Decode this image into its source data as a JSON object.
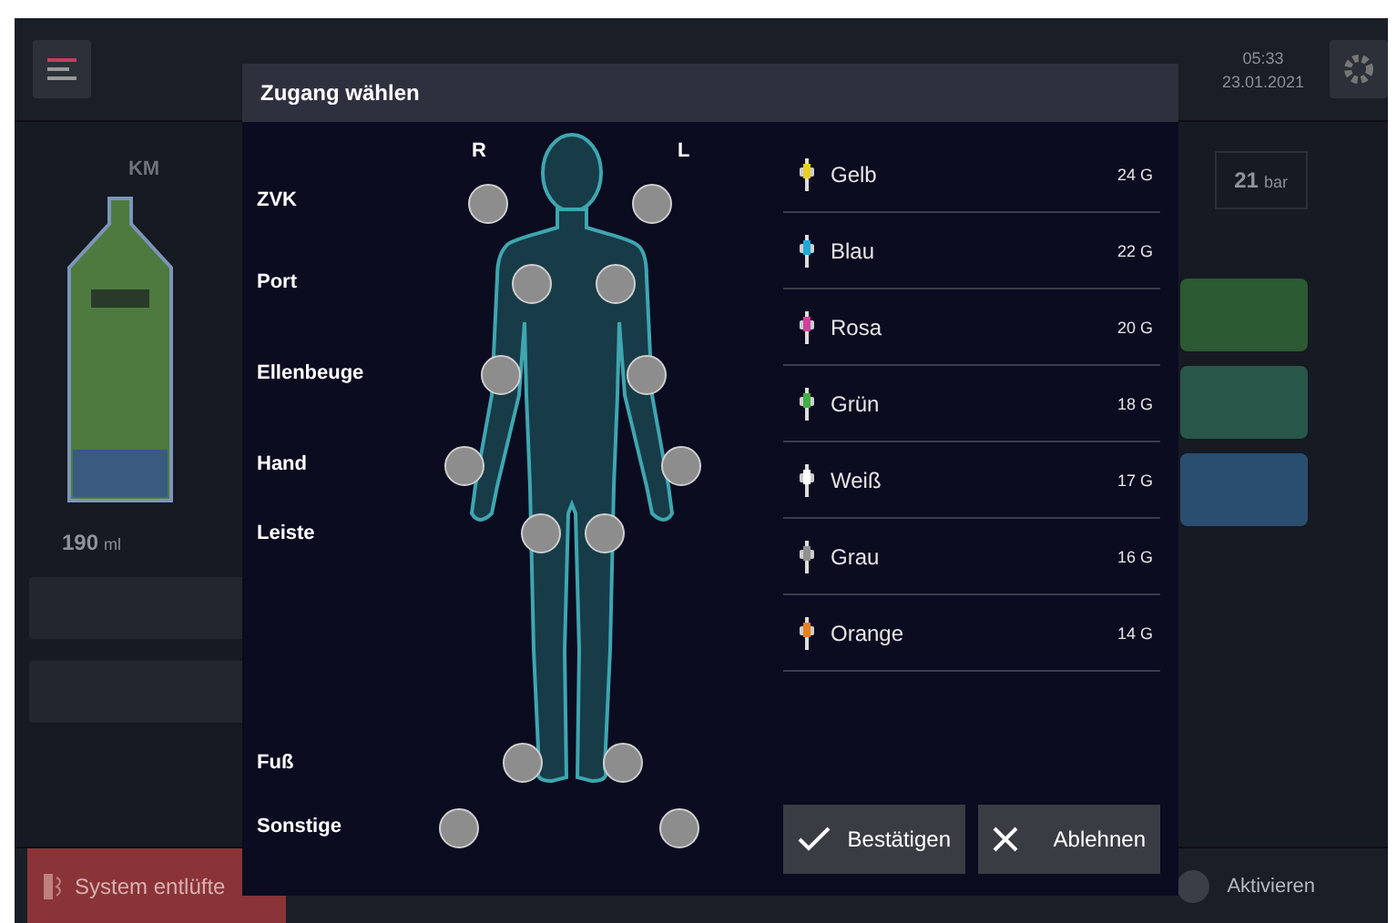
{
  "top_bar": {
    "time": "05:33",
    "date": "23.01.2021"
  },
  "left_panel": {
    "label": "KM",
    "volume": "190",
    "unit": "ml"
  },
  "right_panel": {
    "pressure": "21",
    "unit": "bar"
  },
  "bottom_bar": {
    "vent_button": "System entlüfte",
    "activate": "Aktivieren"
  },
  "dialog": {
    "title": "Zugang wählen",
    "side_labels": [
      "R",
      "L"
    ],
    "sites": [
      {
        "label": "ZVK",
        "points": [
          {
            "selected": false
          },
          {
            "selected": false
          }
        ]
      },
      {
        "label": "Port",
        "points": [
          {
            "selected": false
          },
          {
            "selected": false
          }
        ]
      },
      {
        "label": "Ellenbeuge",
        "points": [
          {
            "selected": false
          },
          {
            "selected": false
          }
        ]
      },
      {
        "label": "Hand",
        "points": [
          {
            "selected": false
          },
          {
            "selected": false
          }
        ]
      },
      {
        "label": "Leiste",
        "points": [
          {
            "selected": false
          },
          {
            "selected": false
          }
        ]
      },
      {
        "label": "Fuß",
        "points": [
          {
            "selected": false
          },
          {
            "selected": false
          }
        ]
      },
      {
        "label": "Sonstige",
        "points": [
          {
            "selected": false
          },
          {
            "selected": false
          }
        ]
      }
    ],
    "catheters": [
      {
        "name": "Gelb",
        "gauge": "24 G",
        "color": "#e8d020",
        "selected": false
      },
      {
        "name": "Blau",
        "gauge": "22 G",
        "color": "#20a8d8",
        "selected": false
      },
      {
        "name": "Rosa",
        "gauge": "20 G",
        "color": "#d040a0",
        "selected": false
      },
      {
        "name": "Grün",
        "gauge": "18 G",
        "color": "#40b040",
        "selected": false
      },
      {
        "name": "Weiß",
        "gauge": "17 G",
        "color": "#ffffff",
        "selected": false
      },
      {
        "name": "Grau",
        "gauge": "16 G",
        "color": "#909090",
        "selected": false
      },
      {
        "name": "Orange",
        "gauge": "14 G",
        "color": "#e88020",
        "selected": false
      }
    ],
    "buttons": [
      {
        "kind": "confirm",
        "label": "Bestätigen"
      },
      {
        "kind": "reject",
        "label": "Ablehnen"
      }
    ]
  }
}
